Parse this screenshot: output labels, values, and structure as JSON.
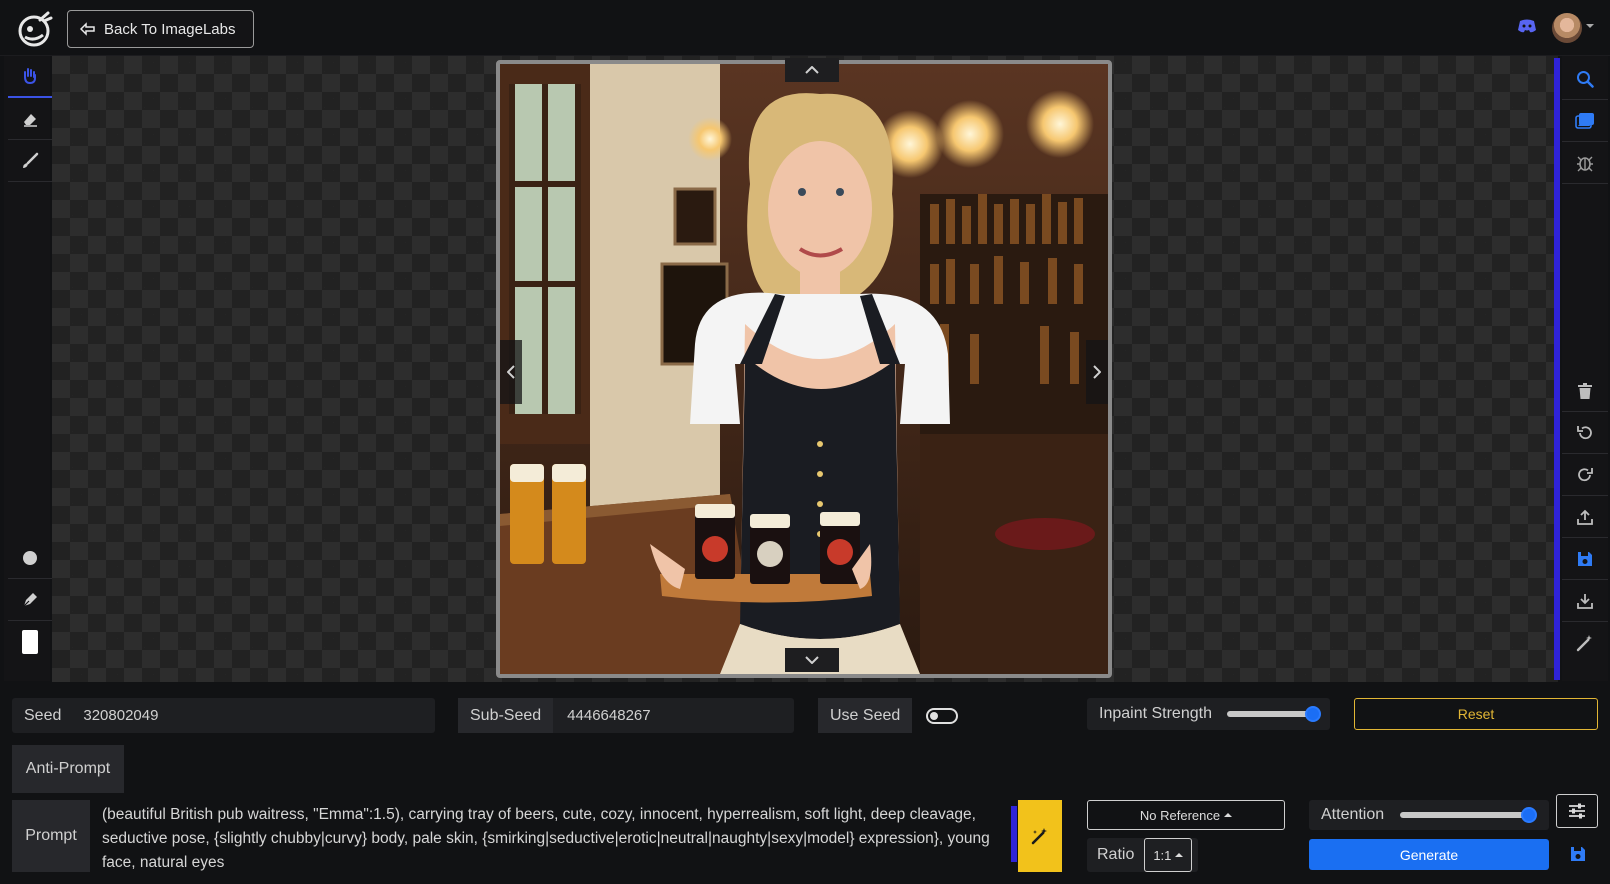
{
  "header": {
    "back_button_label": "Back To ImageLabs"
  },
  "left_tools": [
    "hand",
    "eraser",
    "brush",
    "circle",
    "pen",
    "color-swatch"
  ],
  "right_tools": [
    "search",
    "gallery",
    "bug",
    "delete",
    "undo",
    "redo",
    "upload",
    "save",
    "download",
    "magic-wand"
  ],
  "seed": {
    "label": "Seed",
    "value": "320802049"
  },
  "subseed": {
    "label": "Sub-Seed",
    "value": "4446648267"
  },
  "use_seed": {
    "label": "Use Seed",
    "enabled": false
  },
  "inpaint": {
    "label": "Inpaint Strength",
    "level": 0.95
  },
  "reset_label": "Reset",
  "anti_prompt": {
    "label": "Anti-Prompt",
    "value": ""
  },
  "prompt": {
    "label": "Prompt",
    "value": "(beautiful British pub waitress, \"Emma\":1.5), carrying tray of beers, cute, cozy, innocent, hyperrealism, soft light, deep cleavage, seductive pose, {slightly chubby|curvy} body, pale skin, {smirking|seductive|erotic|neutral|naughty|sexy|model} expression}, young face, natural eyes"
  },
  "reference": {
    "label": "No Reference"
  },
  "ratio": {
    "label": "Ratio",
    "value": "1:1"
  },
  "attention": {
    "label": "Attention",
    "level": 0.98
  },
  "generate_label": "Generate",
  "colors": {
    "accent": "#2f23d8",
    "primary": "#1a6ff2",
    "warning": "#e2b635",
    "magic": "#f2c21b"
  }
}
